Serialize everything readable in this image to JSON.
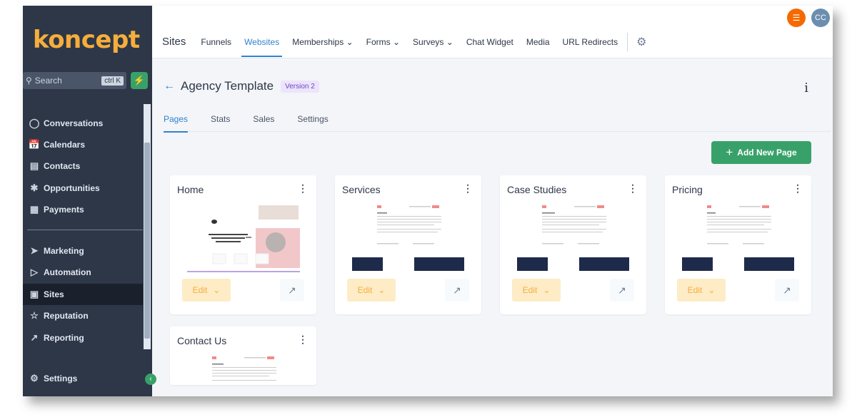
{
  "sidebar": {
    "logo": "koncept",
    "search_placeholder": "Search",
    "search_shortcut": "ctrl K",
    "items_top": [
      {
        "label": "Conversations",
        "icon": "chat-icon"
      },
      {
        "label": "Calendars",
        "icon": "calendar-icon"
      },
      {
        "label": "Contacts",
        "icon": "contacts-icon"
      },
      {
        "label": "Opportunities",
        "icon": "opportunities-icon"
      },
      {
        "label": "Payments",
        "icon": "payments-icon"
      }
    ],
    "items_bottom": [
      {
        "label": "Marketing",
        "icon": "send-icon"
      },
      {
        "label": "Automation",
        "icon": "automation-icon"
      },
      {
        "label": "Sites",
        "icon": "sites-icon",
        "active": true
      },
      {
        "label": "Reputation",
        "icon": "star-icon"
      },
      {
        "label": "Reporting",
        "icon": "chart-icon"
      }
    ],
    "settings_label": "Settings"
  },
  "topbar": {
    "title": "Sites",
    "nav": [
      "Funnels",
      "Websites",
      "Memberships",
      "Forms",
      "Surveys",
      "Chat Widget",
      "Media",
      "URL Redirects"
    ],
    "active": "Websites",
    "dropdowns": [
      "Memberships",
      "Forms",
      "Surveys"
    ],
    "avatar_initials": "CC"
  },
  "page": {
    "title": "Agency Template",
    "version": "Version 2",
    "tabs": [
      "Pages",
      "Stats",
      "Sales",
      "Settings"
    ],
    "active_tab": "Pages",
    "add_button": "Add New Page",
    "edit_label": "Edit"
  },
  "cards": [
    {
      "name": "Home"
    },
    {
      "name": "Services"
    },
    {
      "name": "Case Studies"
    },
    {
      "name": "Pricing"
    },
    {
      "name": "Contact Us"
    }
  ],
  "colors": {
    "sidebar_bg": "#2d3748",
    "accent_blue": "#3182ce",
    "accent_green": "#38a169",
    "logo_orange": "#f6ad3b",
    "version_badge": "#6b46c1"
  }
}
